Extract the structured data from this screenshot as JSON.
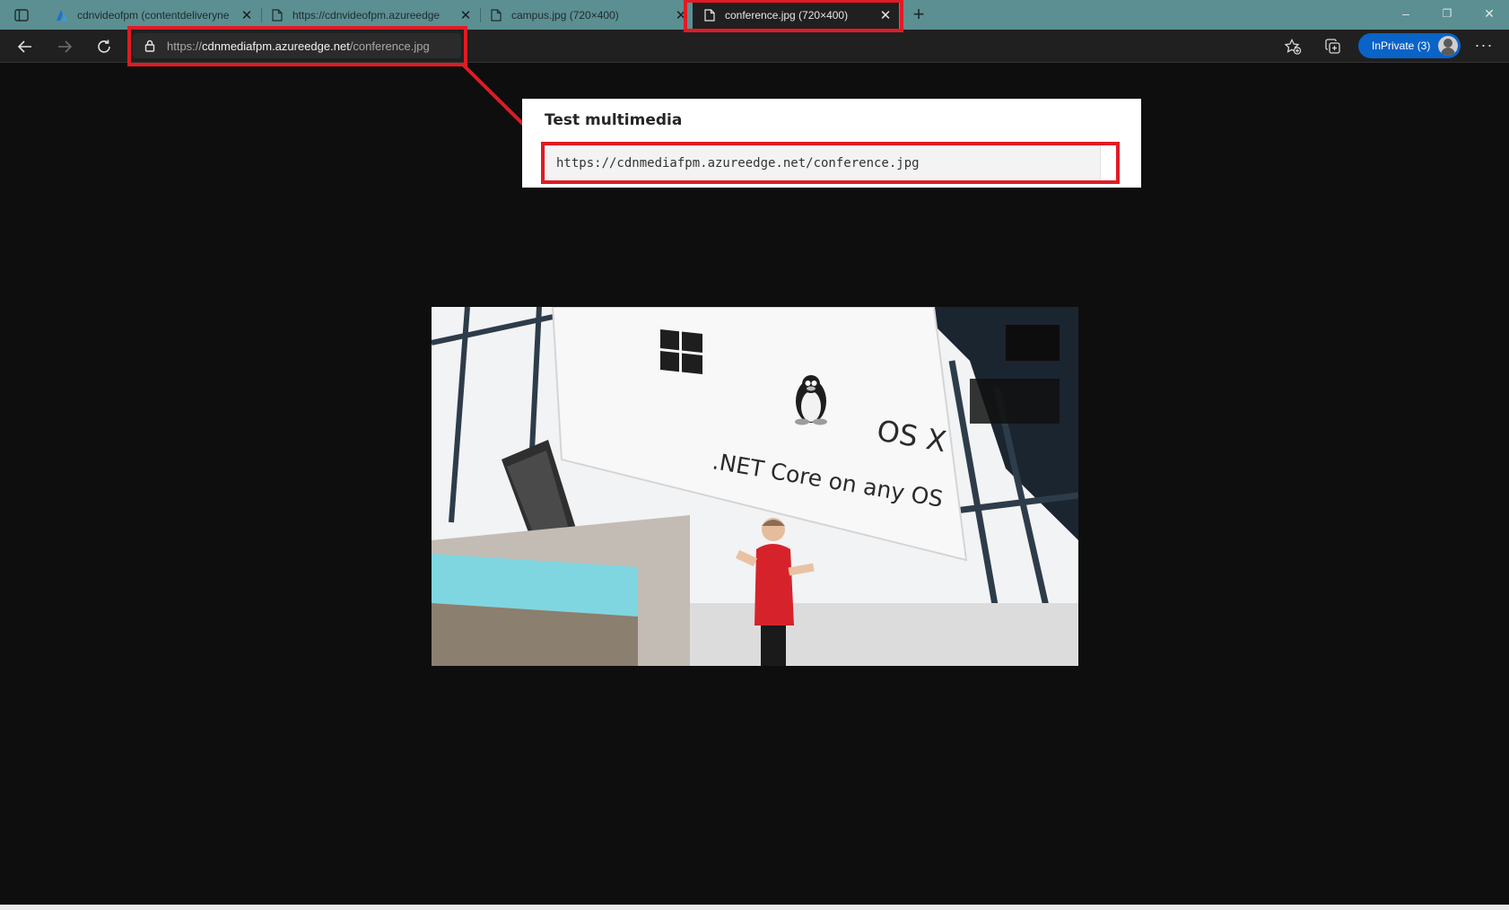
{
  "browser": {
    "tabs": [
      {
        "title": "cdnvideofpm (contentdeliveryne",
        "icon": "azure-icon",
        "active": false
      },
      {
        "title": "https://cdnvideofpm.azureedge",
        "icon": "page-icon",
        "active": false
      },
      {
        "title": "campus.jpg (720×400)",
        "icon": "page-icon",
        "active": false
      },
      {
        "title": "conference.jpg (720×400)",
        "icon": "page-icon",
        "active": true
      }
    ],
    "new_tab_label": "+",
    "window_controls": [
      "–",
      "❐",
      "✕"
    ],
    "address": {
      "scheme": "https://",
      "host": "cdnmediafpm.azureedge.net",
      "path": "/conference.jpg"
    },
    "inprivate_label": "InPrivate (3)",
    "more_label": "···"
  },
  "callout": {
    "title": "Test multimedia",
    "url": "https://cdnmediafpm.azureedge.net/conference.jpg"
  },
  "photo": {
    "slide_line1": "OS X",
    "slide_line2": ".NET Core on any OS"
  },
  "colors": {
    "highlight": "#e01b24",
    "tabstrip": "#5c8f92",
    "page_bg": "#0e0e0e",
    "inprivate": "#0a63c7"
  }
}
